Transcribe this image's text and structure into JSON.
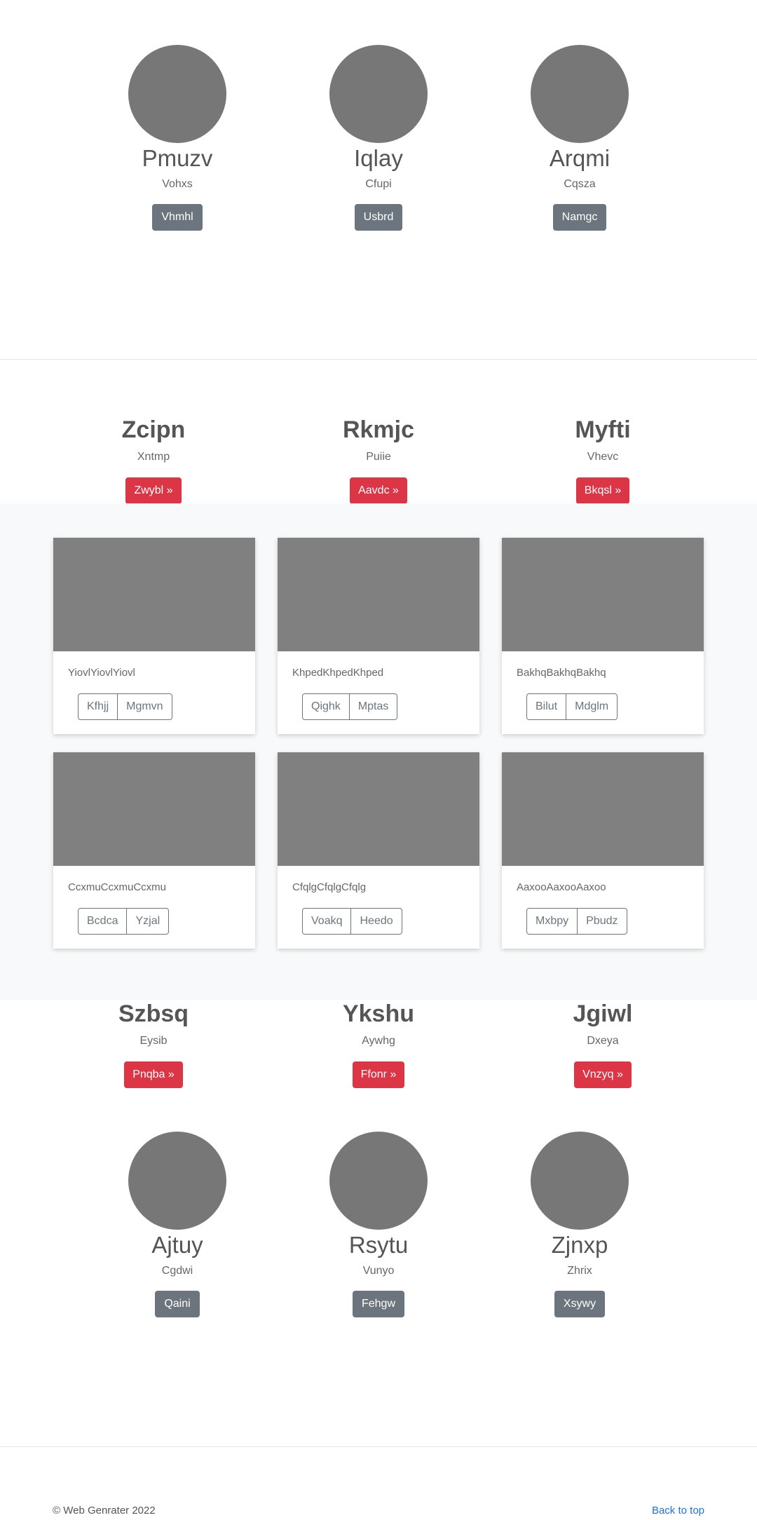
{
  "avatar_row_1": [
    {
      "name": "Pmuzv",
      "sub": "Vohxs",
      "button": "Vhmhl"
    },
    {
      "name": "Iqlay",
      "sub": "Cfupi",
      "button": "Usbrd"
    },
    {
      "name": "Arqmi",
      "sub": "Cqsza",
      "button": "Namgc"
    }
  ],
  "features_1": [
    {
      "title": "Zcipn",
      "sub": "Xntmp",
      "button": "Zwybl »"
    },
    {
      "title": "Rkmjc",
      "sub": "Puiie",
      "button": "Aavdc »"
    },
    {
      "title": "Myfti",
      "sub": "Vhevc",
      "button": "Bkqsl »"
    }
  ],
  "album": {
    "cards": [
      {
        "text": "YiovlYiovlYiovl",
        "btn1": "Kfhjj",
        "btn2": "Mgmvn"
      },
      {
        "text": "KhpedKhpedKhped",
        "btn1": "Qighk",
        "btn2": "Mptas"
      },
      {
        "text": "BakhqBakhqBakhq",
        "btn1": "Bilut",
        "btn2": "Mdglm"
      },
      {
        "text": "CcxmuCcxmuCcxmu",
        "btn1": "Bcdca",
        "btn2": "Yzjal"
      },
      {
        "text": "CfqlgCfqlgCfqlg",
        "btn1": "Voakq",
        "btn2": "Heedo"
      },
      {
        "text": "AaxooAaxooAaxoo",
        "btn1": "Mxbpy",
        "btn2": "Pbudz"
      }
    ]
  },
  "features_2": [
    {
      "title": "Szbsq",
      "sub": "Eysib",
      "button": "Pnqba »"
    },
    {
      "title": "Ykshu",
      "sub": "Aywhg",
      "button": "Ffonr »"
    },
    {
      "title": "Jgiwl",
      "sub": "Dxeya",
      "button": "Vnzyq »"
    }
  ],
  "avatar_row_2": [
    {
      "name": "Ajtuy",
      "sub": "Cgdwi",
      "button": "Qaini"
    },
    {
      "name": "Rsytu",
      "sub": "Vunyo",
      "button": "Fehgw"
    },
    {
      "name": "Zjnxp",
      "sub": "Zhrix",
      "button": "Xsywy"
    }
  ],
  "footer": {
    "copyright": "© Web Genrater 2022",
    "back_to_top": "Back to top"
  },
  "colors": {
    "gray_button": "#6c757d",
    "red_button": "#dc3545",
    "link": "#1a73e8",
    "placeholder": "#808080",
    "album_bg": "#f8f9fa"
  }
}
